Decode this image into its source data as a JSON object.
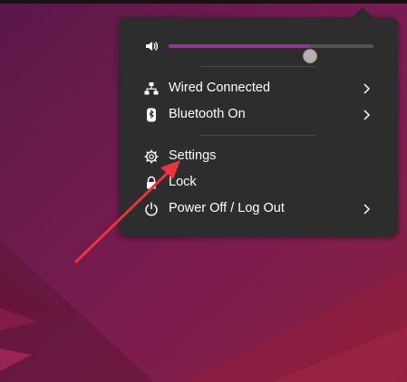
{
  "desktop": {
    "colors": {
      "base": "#5a1846",
      "accent_red": "#e8343a",
      "panel": "#2d2d2d",
      "slider_accent": "#8b3a8f"
    }
  },
  "volume": {
    "icon": "speaker-icon",
    "level": 0.69
  },
  "menu_items": [
    {
      "label": "Wired Connected",
      "icon": "wired-network-icon",
      "has_submenu": true
    },
    {
      "label": "Bluetooth On",
      "icon": "bluetooth-icon",
      "has_submenu": true
    },
    {
      "label": "Settings",
      "icon": "settings-gear-icon",
      "has_submenu": false
    },
    {
      "label": "Lock",
      "icon": "lock-icon",
      "has_submenu": false
    },
    {
      "label": "Power Off / Log Out",
      "icon": "power-icon",
      "has_submenu": true
    }
  ],
  "annotation": {
    "type": "arrow",
    "color": "#e8343a",
    "points_to": "Settings"
  }
}
